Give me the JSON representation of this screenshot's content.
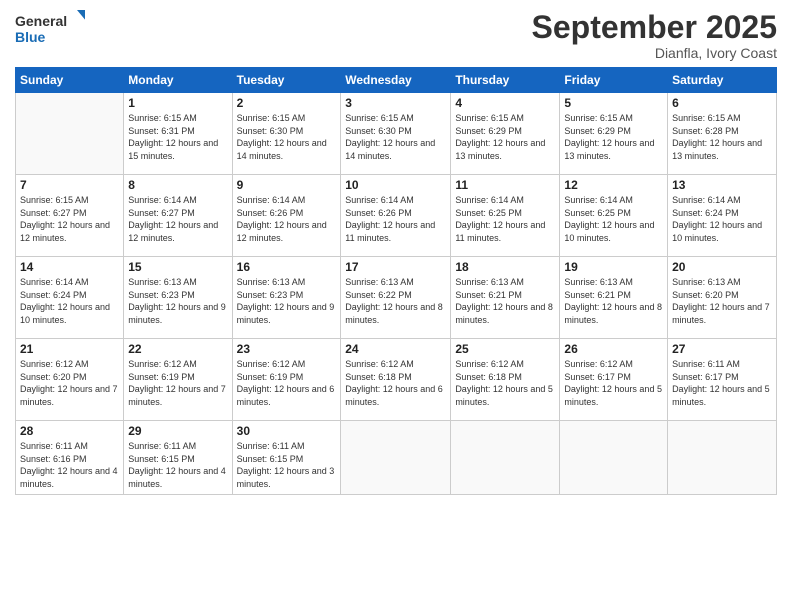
{
  "logo": {
    "line1": "General",
    "line2": "Blue"
  },
  "title": "September 2025",
  "subtitle": "Dianfla, Ivory Coast",
  "weekdays": [
    "Sunday",
    "Monday",
    "Tuesday",
    "Wednesday",
    "Thursday",
    "Friday",
    "Saturday"
  ],
  "weeks": [
    [
      {
        "day": "",
        "info": ""
      },
      {
        "day": "1",
        "info": "Sunrise: 6:15 AM\nSunset: 6:31 PM\nDaylight: 12 hours\nand 15 minutes."
      },
      {
        "day": "2",
        "info": "Sunrise: 6:15 AM\nSunset: 6:30 PM\nDaylight: 12 hours\nand 14 minutes."
      },
      {
        "day": "3",
        "info": "Sunrise: 6:15 AM\nSunset: 6:30 PM\nDaylight: 12 hours\nand 14 minutes."
      },
      {
        "day": "4",
        "info": "Sunrise: 6:15 AM\nSunset: 6:29 PM\nDaylight: 12 hours\nand 13 minutes."
      },
      {
        "day": "5",
        "info": "Sunrise: 6:15 AM\nSunset: 6:29 PM\nDaylight: 12 hours\nand 13 minutes."
      },
      {
        "day": "6",
        "info": "Sunrise: 6:15 AM\nSunset: 6:28 PM\nDaylight: 12 hours\nand 13 minutes."
      }
    ],
    [
      {
        "day": "7",
        "info": "Sunrise: 6:15 AM\nSunset: 6:27 PM\nDaylight: 12 hours\nand 12 minutes."
      },
      {
        "day": "8",
        "info": "Sunrise: 6:14 AM\nSunset: 6:27 PM\nDaylight: 12 hours\nand 12 minutes."
      },
      {
        "day": "9",
        "info": "Sunrise: 6:14 AM\nSunset: 6:26 PM\nDaylight: 12 hours\nand 12 minutes."
      },
      {
        "day": "10",
        "info": "Sunrise: 6:14 AM\nSunset: 6:26 PM\nDaylight: 12 hours\nand 11 minutes."
      },
      {
        "day": "11",
        "info": "Sunrise: 6:14 AM\nSunset: 6:25 PM\nDaylight: 12 hours\nand 11 minutes."
      },
      {
        "day": "12",
        "info": "Sunrise: 6:14 AM\nSunset: 6:25 PM\nDaylight: 12 hours\nand 10 minutes."
      },
      {
        "day": "13",
        "info": "Sunrise: 6:14 AM\nSunset: 6:24 PM\nDaylight: 12 hours\nand 10 minutes."
      }
    ],
    [
      {
        "day": "14",
        "info": "Sunrise: 6:14 AM\nSunset: 6:24 PM\nDaylight: 12 hours\nand 10 minutes."
      },
      {
        "day": "15",
        "info": "Sunrise: 6:13 AM\nSunset: 6:23 PM\nDaylight: 12 hours\nand 9 minutes."
      },
      {
        "day": "16",
        "info": "Sunrise: 6:13 AM\nSunset: 6:23 PM\nDaylight: 12 hours\nand 9 minutes."
      },
      {
        "day": "17",
        "info": "Sunrise: 6:13 AM\nSunset: 6:22 PM\nDaylight: 12 hours\nand 8 minutes."
      },
      {
        "day": "18",
        "info": "Sunrise: 6:13 AM\nSunset: 6:21 PM\nDaylight: 12 hours\nand 8 minutes."
      },
      {
        "day": "19",
        "info": "Sunrise: 6:13 AM\nSunset: 6:21 PM\nDaylight: 12 hours\nand 8 minutes."
      },
      {
        "day": "20",
        "info": "Sunrise: 6:13 AM\nSunset: 6:20 PM\nDaylight: 12 hours\nand 7 minutes."
      }
    ],
    [
      {
        "day": "21",
        "info": "Sunrise: 6:12 AM\nSunset: 6:20 PM\nDaylight: 12 hours\nand 7 minutes."
      },
      {
        "day": "22",
        "info": "Sunrise: 6:12 AM\nSunset: 6:19 PM\nDaylight: 12 hours\nand 7 minutes."
      },
      {
        "day": "23",
        "info": "Sunrise: 6:12 AM\nSunset: 6:19 PM\nDaylight: 12 hours\nand 6 minutes."
      },
      {
        "day": "24",
        "info": "Sunrise: 6:12 AM\nSunset: 6:18 PM\nDaylight: 12 hours\nand 6 minutes."
      },
      {
        "day": "25",
        "info": "Sunrise: 6:12 AM\nSunset: 6:18 PM\nDaylight: 12 hours\nand 5 minutes."
      },
      {
        "day": "26",
        "info": "Sunrise: 6:12 AM\nSunset: 6:17 PM\nDaylight: 12 hours\nand 5 minutes."
      },
      {
        "day": "27",
        "info": "Sunrise: 6:11 AM\nSunset: 6:17 PM\nDaylight: 12 hours\nand 5 minutes."
      }
    ],
    [
      {
        "day": "28",
        "info": "Sunrise: 6:11 AM\nSunset: 6:16 PM\nDaylight: 12 hours\nand 4 minutes."
      },
      {
        "day": "29",
        "info": "Sunrise: 6:11 AM\nSunset: 6:15 PM\nDaylight: 12 hours\nand 4 minutes."
      },
      {
        "day": "30",
        "info": "Sunrise: 6:11 AM\nSunset: 6:15 PM\nDaylight: 12 hours\nand 3 minutes."
      },
      {
        "day": "",
        "info": ""
      },
      {
        "day": "",
        "info": ""
      },
      {
        "day": "",
        "info": ""
      },
      {
        "day": "",
        "info": ""
      }
    ]
  ]
}
